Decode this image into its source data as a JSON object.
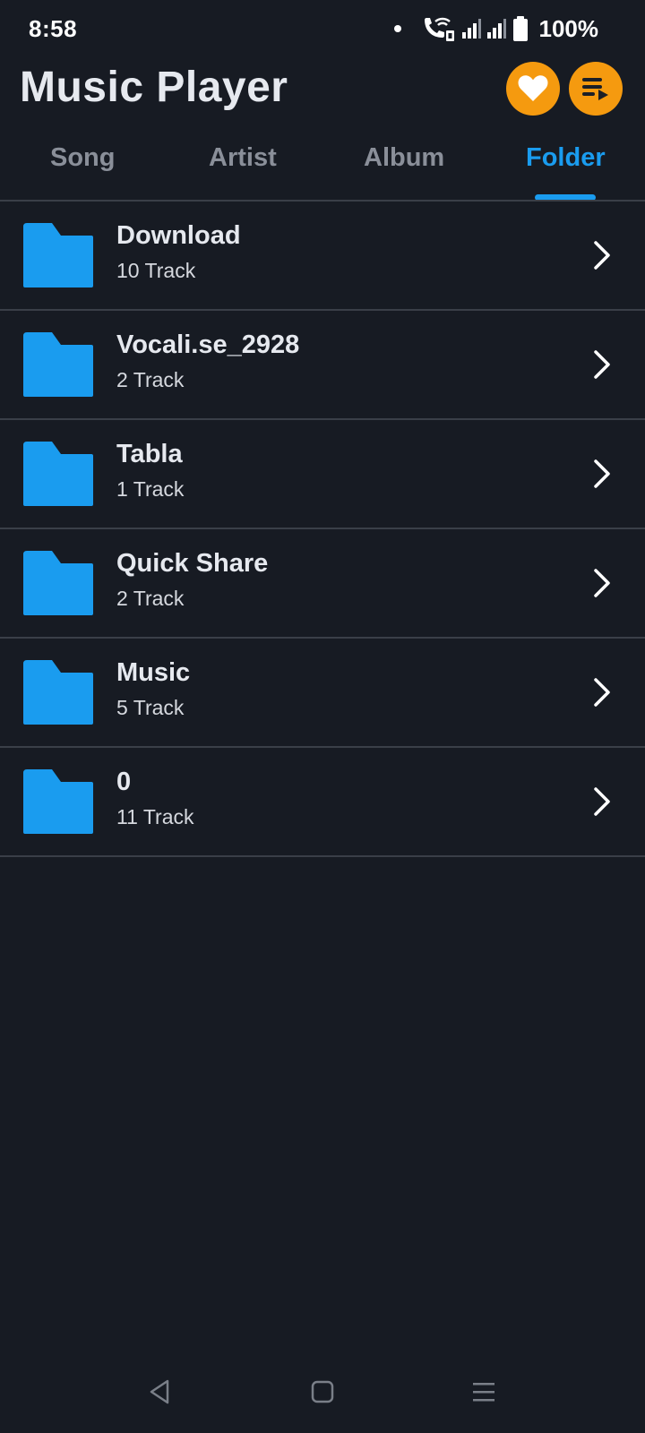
{
  "status_bar": {
    "time": "8:58",
    "battery": "100%",
    "icons": [
      "notification-dot-icon",
      "wifi-calling-icon",
      "signal-icon",
      "signal-icon",
      "battery-icon"
    ]
  },
  "header": {
    "title": "Music Player",
    "accent_color": "#f59a0f",
    "buttons": [
      {
        "name": "favorites-button",
        "icon": "heart-icon"
      },
      {
        "name": "queue-button",
        "icon": "playlist-icon"
      }
    ]
  },
  "tabs": [
    {
      "label": "Song",
      "active": false
    },
    {
      "label": "Artist",
      "active": false
    },
    {
      "label": "Album",
      "active": false
    },
    {
      "label": "Folder",
      "active": true
    }
  ],
  "tab_active_color": "#1a9cef",
  "folder_icon_color": "#1a9cef",
  "folders": [
    {
      "name": "Download",
      "count": "10 Track"
    },
    {
      "name": "Vocali.se_2928",
      "count": "2 Track"
    },
    {
      "name": "Tabla",
      "count": "1 Track"
    },
    {
      "name": "Quick Share",
      "count": "2 Track"
    },
    {
      "name": "Music",
      "count": "5 Track"
    },
    {
      "name": "0",
      "count": "11 Track"
    }
  ],
  "nav_bar": {
    "icons": [
      "back-icon",
      "home-icon",
      "recents-icon"
    ]
  }
}
